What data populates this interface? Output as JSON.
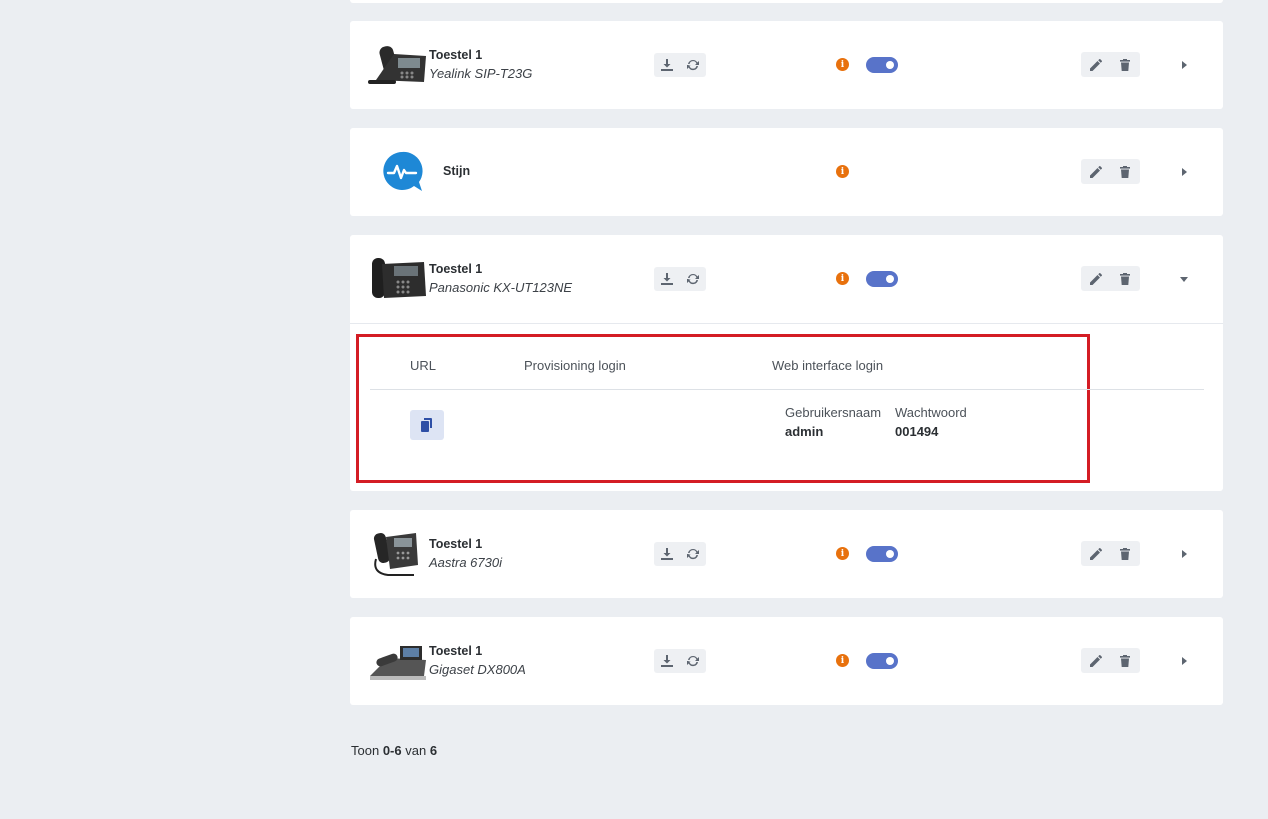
{
  "devices": [
    {
      "title": "Toestel 1",
      "model": "Yealink SIP-T23G",
      "icon": "phone-icon",
      "has_provision": true,
      "has_toggle": true,
      "expanded": false
    },
    {
      "title": "Stijn",
      "model": "",
      "icon": "softphone-app-icon",
      "has_provision": false,
      "has_toggle": false,
      "expanded": false
    },
    {
      "title": "Toestel 1",
      "model": "Panasonic KX-UT123NE",
      "icon": "phone-icon",
      "has_provision": true,
      "has_toggle": true,
      "expanded": true
    },
    {
      "title": "Toestel 1",
      "model": "Aastra 6730i",
      "icon": "phone-icon",
      "has_provision": true,
      "has_toggle": true,
      "expanded": false
    },
    {
      "title": "Toestel 1",
      "model": "Gigaset DX800A",
      "icon": "phone-icon",
      "has_provision": true,
      "has_toggle": true,
      "expanded": false
    }
  ],
  "detail": {
    "col_url": "URL",
    "col_provisioning": "Provisioning login",
    "col_web": "Web interface login",
    "username_label": "Gebruikersnaam",
    "username_value": "admin",
    "password_label": "Wachtwoord",
    "password_value": "001494"
  },
  "footer": {
    "prefix": "Toon",
    "range": "0-6",
    "middle": "van",
    "total": "6"
  },
  "colors": {
    "info": "#e8710d",
    "toggle": "#5873c9",
    "highlight": "#d41c24",
    "app_icon": "#1e88d6"
  }
}
